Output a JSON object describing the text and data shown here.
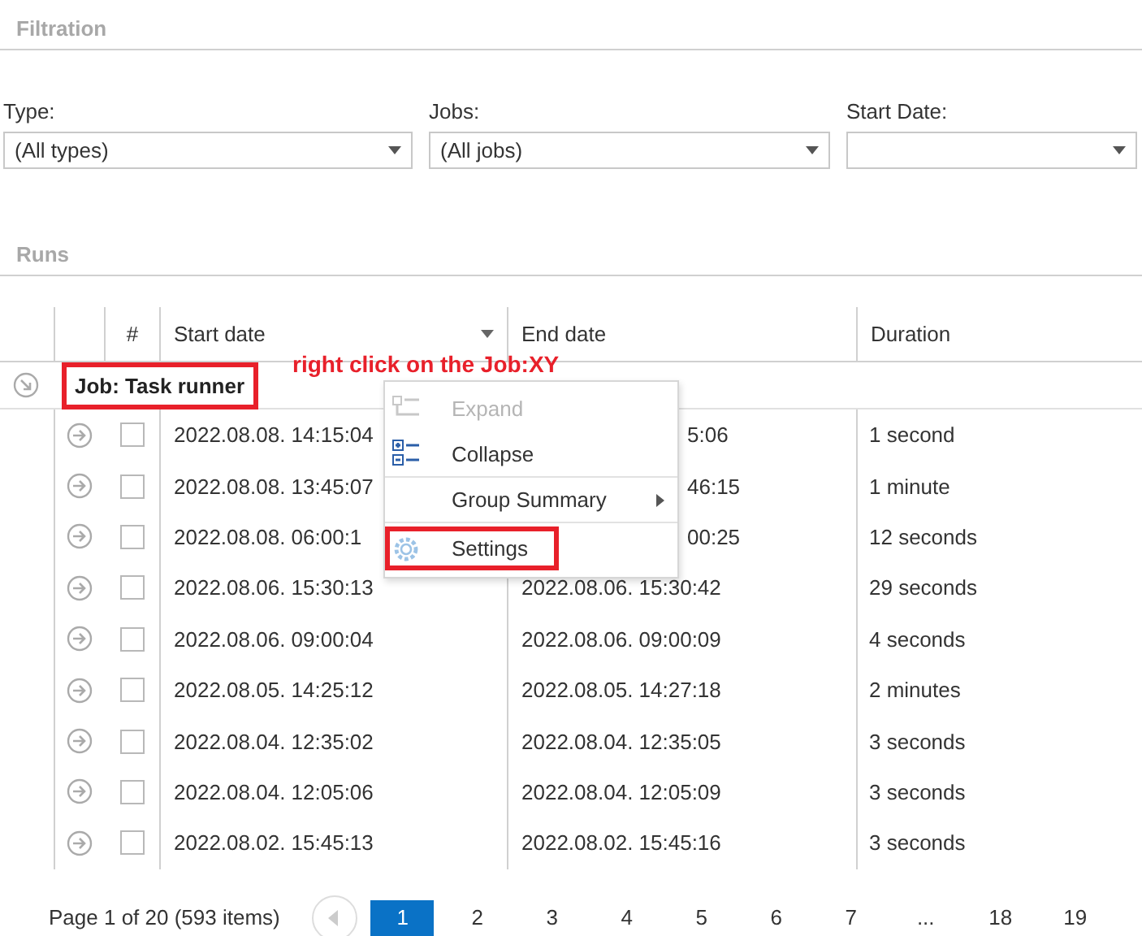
{
  "filtration": {
    "title": "Filtration",
    "filters": [
      {
        "label": "Type:",
        "value": "(All types)"
      },
      {
        "label": "Jobs:",
        "value": "(All jobs)"
      },
      {
        "label": "Start Date:"
      }
    ]
  },
  "runs": {
    "title": "Runs",
    "columns": [
      {
        "label": "#",
        "sorted": false
      },
      {
        "label": "Start date",
        "sorted": true
      },
      {
        "label": "End date",
        "sorted": false
      },
      {
        "label": "Duration",
        "sorted": false
      }
    ],
    "group": {
      "label": "Job: Task runner",
      "expanded": true
    },
    "rows": [
      {
        "checked": false,
        "start_date": "2022.08.08. 14:15:04",
        "end_date": "5:06",
        "end_covered": true,
        "duration": "1 second"
      },
      {
        "checked": false,
        "start_date": "2022.08.08. 13:45:07",
        "end_date": "46:15",
        "end_covered": true,
        "duration": "1 minute"
      },
      {
        "checked": false,
        "start_date": "2022.08.08. 06:00:1",
        "end_date": "00:25",
        "end_covered": true,
        "duration": "12 seconds"
      },
      {
        "checked": false,
        "start_date": "2022.08.06. 15:30:13",
        "end_date": "2022.08.06. 15:30:42",
        "end_covered": false,
        "duration": "29 seconds"
      },
      {
        "checked": false,
        "start_date": "2022.08.06. 09:00:04",
        "end_date": "2022.08.06. 09:00:09",
        "end_covered": false,
        "duration": "4 seconds"
      },
      {
        "checked": false,
        "start_date": "2022.08.05. 14:25:12",
        "end_date": "2022.08.05. 14:27:18",
        "end_covered": false,
        "duration": "2 minutes"
      },
      {
        "checked": false,
        "start_date": "2022.08.04. 12:35:02",
        "end_date": "2022.08.04. 12:35:05",
        "end_covered": false,
        "duration": "3 seconds"
      },
      {
        "checked": false,
        "start_date": "2022.08.04. 12:05:06",
        "end_date": "2022.08.04. 12:05:09",
        "end_covered": false,
        "duration": "3 seconds"
      },
      {
        "checked": false,
        "start_date": "2022.08.02. 15:45:13",
        "end_date": "2022.08.02. 15:45:16",
        "end_covered": false,
        "duration": "3 seconds"
      }
    ],
    "pager": {
      "summary": "Page 1 of 20 (593 items)",
      "pages": [
        {
          "label": "1",
          "selected": true
        },
        {
          "label": "2",
          "selected": false
        },
        {
          "label": "3",
          "selected": false
        },
        {
          "label": "4",
          "selected": false
        },
        {
          "label": "5",
          "selected": false
        },
        {
          "label": "6",
          "selected": false
        },
        {
          "label": "7",
          "selected": false
        },
        {
          "label": "...",
          "selected": false
        },
        {
          "label": "18",
          "selected": false
        },
        {
          "label": "19",
          "selected": false
        }
      ]
    }
  },
  "context_menu": {
    "items": [
      {
        "kind": "expand",
        "label": "Expand",
        "disabled": true,
        "submenu": false,
        "highlighted": false
      },
      {
        "kind": "collapse",
        "label": "Collapse",
        "disabled": false,
        "submenu": false,
        "highlighted": false
      },
      {
        "kind": "plain",
        "label": "Group Summary",
        "disabled": false,
        "submenu": true,
        "highlighted": false
      },
      {
        "kind": "settings",
        "label": "Settings",
        "disabled": false,
        "submenu": false,
        "highlighted": true
      }
    ]
  },
  "annotation": {
    "text": "right click on the Job:XY",
    "group_highlighted": true
  }
}
